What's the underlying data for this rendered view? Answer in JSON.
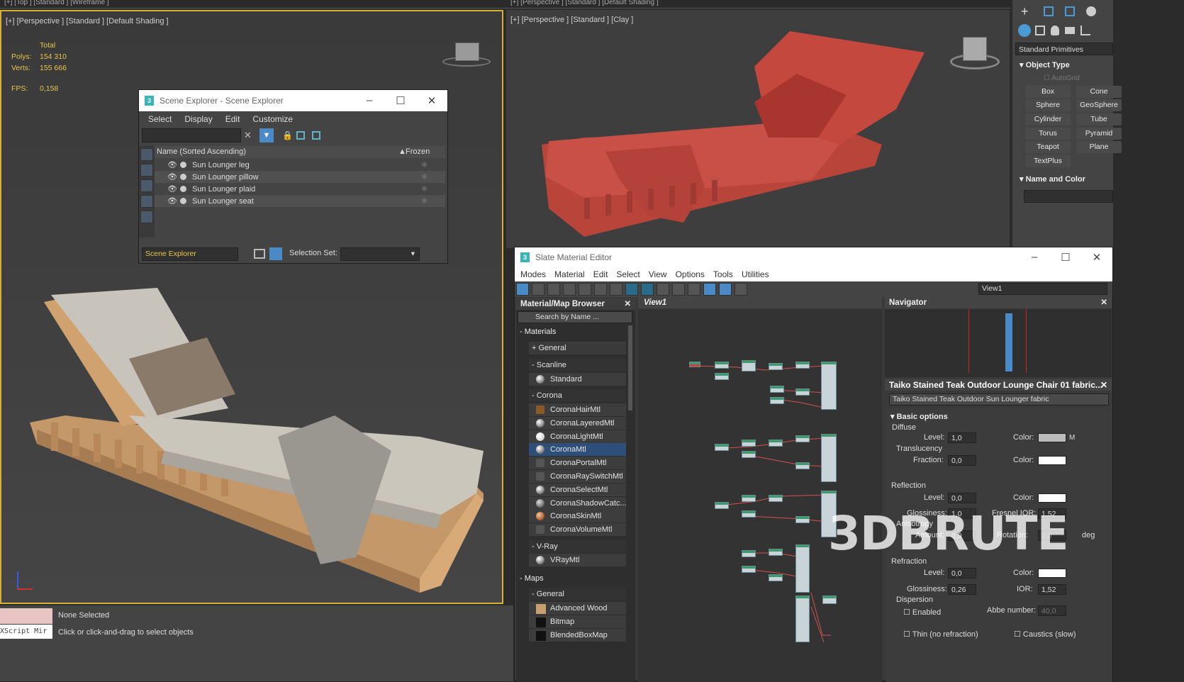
{
  "top_strip": {
    "left": "[+] [Top ] [Standard ] [Wireframe ]",
    "right": "[+] [Perspective ] [Standard ] [Default Shading ]"
  },
  "viewport_left": {
    "label": "[+] [Perspective ] [Standard ] [Default Shading ]",
    "stats": {
      "total": "Total",
      "polys_label": "Polys:",
      "polys": "154 310",
      "verts_label": "Verts:",
      "verts": "155 666",
      "fps_label": "FPS:",
      "fps": "0,158"
    }
  },
  "viewport_right": {
    "label": "[+] [Perspective ] [Standard ] [Clay ]"
  },
  "scene_explorer": {
    "title": "Scene Explorer - Scene Explorer",
    "menu": [
      "Select",
      "Display",
      "Edit",
      "Customize"
    ],
    "col_name": "Name (Sorted Ascending)",
    "col_frozen": "Frozen",
    "items": [
      "Sun Lounger leg",
      "Sun Lounger pillow",
      "Sun Lounger plaid",
      "Sun Lounger seat"
    ],
    "bottom_dropdown": "Scene Explorer",
    "selection_set": "Selection Set:"
  },
  "command_panel": {
    "dropdown": "Standard Primitives",
    "object_type": "Object Type",
    "autogrid": "AutoGrid",
    "buttons": [
      "Box",
      "Cone",
      "Sphere",
      "GeoSphere",
      "Cylinder",
      "Tube",
      "Torus",
      "Pyramid",
      "Teapot",
      "Plane",
      "TextPlus"
    ],
    "name_color": "Name and Color"
  },
  "slate": {
    "title": "Slate Material Editor",
    "menu": [
      "Modes",
      "Material",
      "Edit",
      "Select",
      "View",
      "Options",
      "Tools",
      "Utilities"
    ],
    "view_dropdown": "View1",
    "browser": {
      "title": "Material/Map Browser",
      "search": "Search by Name ...",
      "materials": "Materials",
      "general": "+ General",
      "scanline": "Scanline",
      "standard": "Standard",
      "corona": "Corona",
      "corona_items": [
        "CoronaHairMtl",
        "CoronaLayeredMtl",
        "CoronaLightMtl",
        "CoronaMtl",
        "CoronaPortalMtl",
        "CoronaRaySwitchMtl",
        "CoronaSelectMtl",
        "CoronaShadowCatc...",
        "CoronaSkinMtl",
        "CoronaVolumeMtl"
      ],
      "vray": "V-Ray",
      "vray_item": "VRayMtl",
      "maps": "Maps",
      "maps_general": "General",
      "map_items": [
        "Advanced Wood",
        "Bitmap",
        "BlendedBoxMap"
      ]
    },
    "view_tab": "View1",
    "navigator": "Navigator",
    "params": {
      "header": "Taiko Stained Teak Outdoor Lounge Chair 01 fabric...",
      "name": "Taiko Stained Teak Outdoor Sun Lounger fabric",
      "basic": "Basic options",
      "diffuse": "Diffuse",
      "level": "Level:",
      "level_val": "1,0",
      "color": "Color:",
      "m": "M",
      "translucency": "Translucency",
      "fraction": "Fraction:",
      "fraction_val": "0,0",
      "reflection": "Reflection",
      "refl_level": "0,0",
      "glossiness": "Glossiness:",
      "gloss_val": "1,0",
      "fresnel": "Fresnel IOR:",
      "fresnel_val": "1,52",
      "anisotropy": "Anisotropy",
      "amount": "Amount:",
      "amount_val": "0,0",
      "rotation": "Rotation:",
      "rotation_val": "0,0",
      "deg": "deg",
      "refraction": "Refraction",
      "refr_level": "0,0",
      "refr_gloss": "0,26",
      "ior": "IOR:",
      "ior_val": "1,52",
      "dispersion": "Dispersion",
      "enabled": "Enabled",
      "abbe": "Abbe number:",
      "abbe_val": "40,0",
      "thin": "Thin (no refraction)",
      "caustics": "Caustics (slow)"
    }
  },
  "status": {
    "script": "XScript Mir",
    "selected": "None Selected",
    "hint": "Click or click-and-drag to select objects"
  },
  "watermark": "3DBRUTE"
}
